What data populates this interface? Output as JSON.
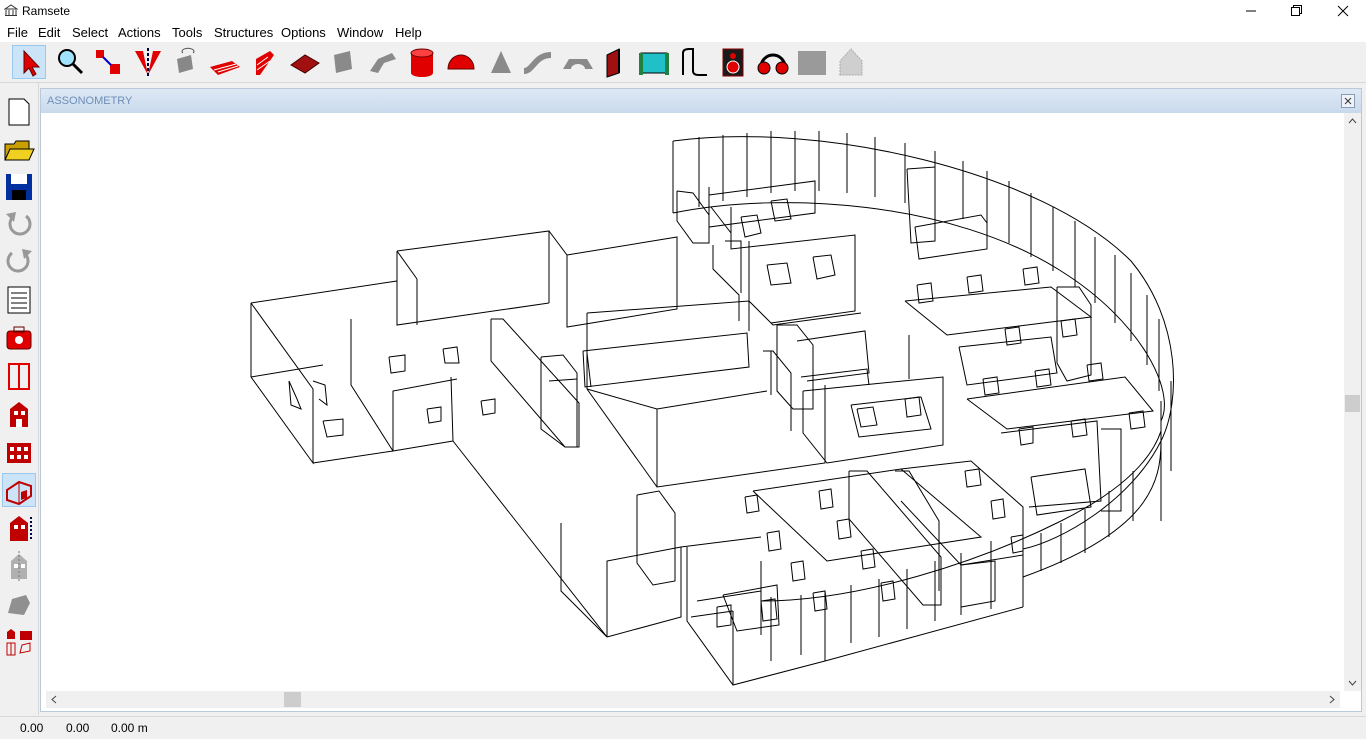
{
  "app": {
    "title": "Ramsete"
  },
  "menu": {
    "items": [
      "File",
      "Edit",
      "Select",
      "Actions",
      "Tools",
      "Structures",
      "Options",
      "Window",
      "Help"
    ]
  },
  "toolbar": {
    "buttons": [
      "pointer-arrow-icon",
      "zoom-magnifier-icon",
      "move-connect-icon",
      "cut-plane-icon",
      "rotate-object-icon",
      "floor-plane-icon",
      "brick-wall-icon",
      "slab-icon",
      "block-icon",
      "bent-surface-icon",
      "cylinder-icon",
      "dome-icon",
      "cone-icon",
      "curve-pipe-icon",
      "arch-icon",
      "door-icon",
      "panel-icon",
      "step-line-icon",
      "speaker-icon",
      "headphones-icon",
      "gray-square-icon",
      "house-outline-icon"
    ]
  },
  "sidebar": {
    "buttons": [
      "new-file-icon",
      "open-folder-icon",
      "save-disk-icon",
      "undo-icon",
      "redo-icon",
      "list-icon",
      "toolbox-icon",
      "columns-icon",
      "building-icon",
      "grid-building-icon",
      "room-perspective-icon",
      "building-layers-icon",
      "building-gray-icon",
      "gray-polygon-icon",
      "building-set-icon"
    ]
  },
  "view": {
    "title": "ASSONOMETRY"
  },
  "status": {
    "x": "0.00",
    "y": "0.00",
    "z": "0.00 m"
  }
}
